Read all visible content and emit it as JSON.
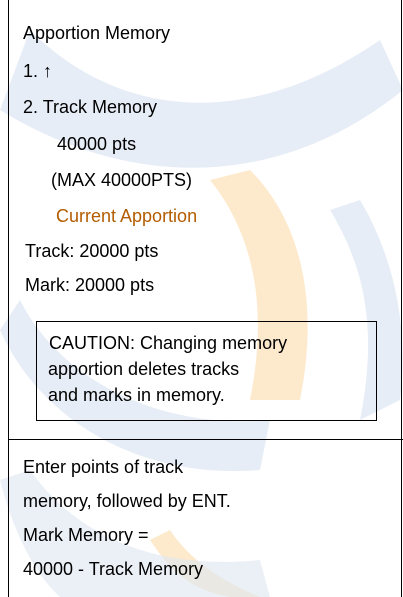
{
  "menu": {
    "title": "Apportion Memory",
    "item1": "1. ↑",
    "item2": "2. Track Memory",
    "track_value": "40000 pts",
    "max_note": "(MAX 40000PTS)",
    "current_apportion_label": "Current Apportion",
    "track_current": "Track: 20000 pts",
    "mark_current": "Mark: 20000 pts"
  },
  "caution": {
    "line1": "CAUTION: Changing memory",
    "line2": "apportion deletes tracks",
    "line3": "and marks in memory."
  },
  "help": {
    "line1": "Enter points of track",
    "line2": "memory, followed by ENT.",
    "line3": "Mark Memory =",
    "line4": "40000 - Track Memory"
  },
  "colors": {
    "accent_text": "#b35c00",
    "border": "#000000",
    "watermark_blue": "#dde6f2",
    "watermark_orange": "#fde8c8"
  },
  "icons": {
    "up_arrow": "up-arrow-icon"
  }
}
